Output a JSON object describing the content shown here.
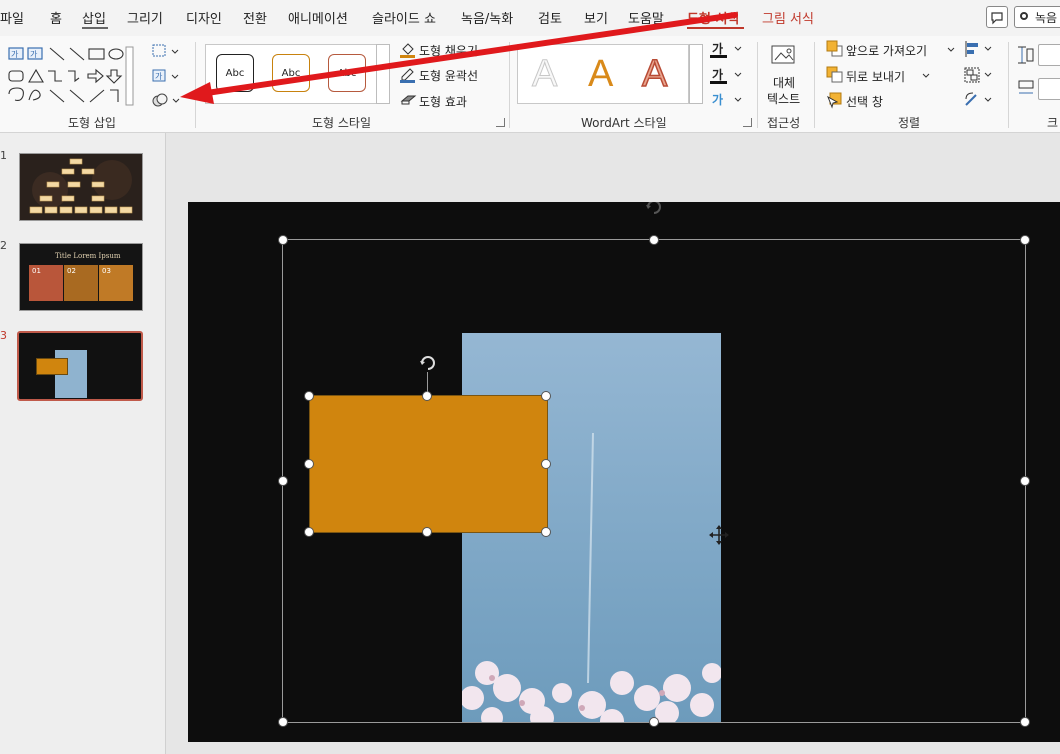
{
  "tabs": {
    "items": [
      "파일",
      "홈",
      "삽입",
      "그리기",
      "디자인",
      "전환",
      "애니메이션",
      "슬라이드 쇼",
      "녹음/녹화",
      "검토",
      "보기",
      "도움말"
    ],
    "contextual_shape_format": "도형 서식",
    "contextual_picture_format": "그림 서식",
    "record_label": "녹음"
  },
  "ribbon": {
    "insert_shapes_group": "도형 삽입",
    "shape_styles_group": "도형 스타일",
    "style_preview_1": "Abc",
    "style_preview_2": "Abc",
    "style_preview_3": "Abc",
    "shape_fill": "도형 채우기",
    "shape_outline": "도형 윤곽선",
    "shape_effects": "도형 효과",
    "wordart_group": "WordArt 스타일",
    "wordart_letter": "A",
    "text_fill_glyph": "가",
    "text_outline_glyph": "가",
    "text_effects_glyph": "가",
    "alt_text_line1": "대체",
    "alt_text_line2": "텍스트",
    "accessibility_group": "접근성",
    "bring_forward": "앞으로 가져오기",
    "send_backward": "뒤로 보내기",
    "selection_pane": "선택 창",
    "arrange_group": "정렬",
    "size_group_partial": "크"
  },
  "slides": {
    "numbers": [
      "1",
      "2",
      "3"
    ],
    "slide2_title": "Title Lorem Ipsum",
    "slide2_cols": [
      "01",
      "02",
      "03"
    ]
  },
  "colors": {
    "accent": "#c0382b",
    "orange_shape": "#d0850e",
    "sky": "#7ea6c4",
    "arrow": "#e0191c"
  }
}
